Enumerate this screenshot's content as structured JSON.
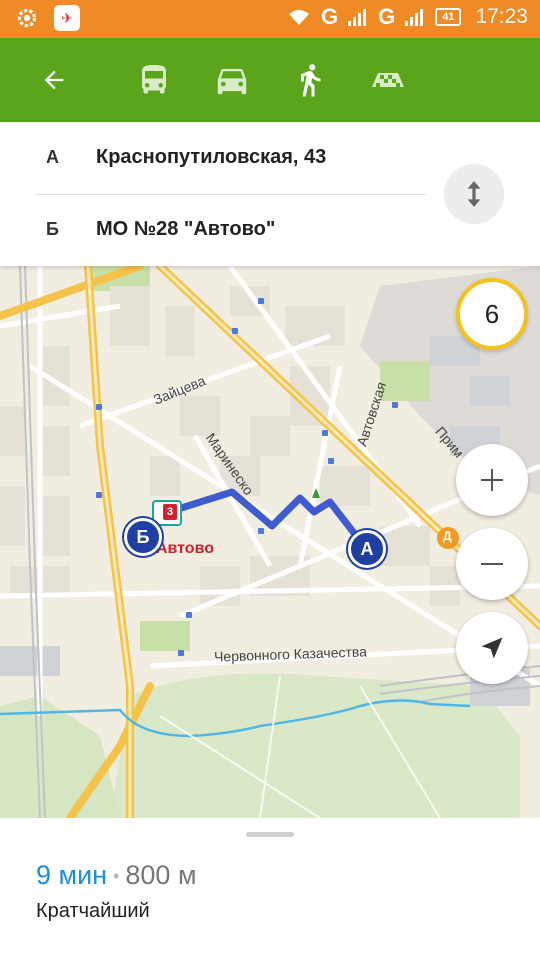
{
  "status_bar": {
    "time": "17:23",
    "battery": "41",
    "network_1": "G",
    "network_2": "G",
    "icons": [
      "settings-gear-icon",
      "app-notification-icon",
      "wifi-icon",
      "signal-icon",
      "battery-icon"
    ]
  },
  "toolbar": {
    "back_icon": "back-arrow-icon",
    "modes": [
      "bus-icon",
      "car-icon",
      "walk-icon",
      "taxi-icon"
    ],
    "active_mode": "walk-icon",
    "color": "#5aa51b"
  },
  "route": {
    "from_label": "А",
    "from_value": "Краснопутиловская, 43",
    "to_label": "Б",
    "to_value": "МО №28 \"Автово\"",
    "swap_icon": "swap-vertical-icon"
  },
  "map": {
    "traffic_level": "6",
    "streets": {
      "zaitseva": "Зайцева",
      "marinesko": "Маринеско",
      "avtovskaya": "Автовская",
      "primorsky": "Прим",
      "chervonnogo": "Червонного Казачества"
    },
    "metro_station": "Автово",
    "metro_line": "3",
    "pin_a": "А",
    "pin_b": "Б",
    "poi_d": "Д",
    "zoom_in": "+",
    "zoom_out": "−",
    "route_color": "#3e5bd1"
  },
  "summary": {
    "time": "9 мин",
    "separator": "•",
    "distance": "800 м",
    "route_type": "Кратчайший"
  }
}
